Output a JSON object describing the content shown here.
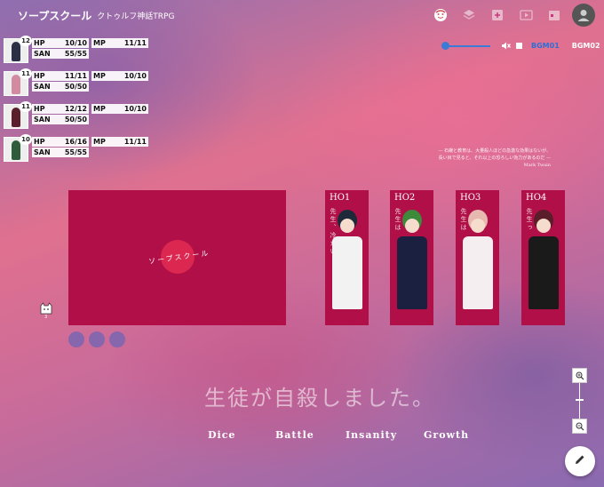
{
  "app": {
    "title": "ソープスクール",
    "subtitle": "クトゥルフ神話TRPG"
  },
  "toolbar": {
    "icons": [
      "face-icon",
      "layers-icon",
      "add-box-icon",
      "play-icon",
      "calendar-icon",
      "account-icon"
    ]
  },
  "bgm": {
    "volume": 0.0,
    "tracks": [
      "BGM01",
      "BGM02"
    ],
    "active_track": "BGM01"
  },
  "characters": [
    {
      "badge": "12",
      "hp_label": "HP",
      "hp": "10/10",
      "mp_label": "MP",
      "mp": "11/11",
      "san_label": "SAN",
      "san": "55/55",
      "color": "#2a2f45"
    },
    {
      "badge": "11",
      "hp_label": "HP",
      "hp": "11/11",
      "mp_label": "MP",
      "mp": "10/10",
      "san_label": "SAN",
      "san": "50/50",
      "color": "#d28ba0"
    },
    {
      "badge": "11",
      "hp_label": "HP",
      "hp": "12/12",
      "mp_label": "MP",
      "mp": "10/10",
      "san_label": "SAN",
      "san": "50/50",
      "color": "#5a1f2a"
    },
    {
      "badge": "10",
      "hp_label": "HP",
      "hp": "16/16",
      "mp_label": "MP",
      "mp": "11/11",
      "san_label": "SAN",
      "san": "55/55",
      "color": "#2e5b3a"
    }
  ],
  "quote": {
    "line1": "— 石鹸と教育は、大量殺人ほどの急激な効果はないが、",
    "line2": "長い目で見ると、それ以上の恐ろしい効力があるのだ —",
    "author": "Mark Twain"
  },
  "logo": {
    "text": "ソープスクール"
  },
  "ho_cards": [
    {
      "label": "HO1",
      "vertical": "先生、冷たい",
      "hair": "#1e2a3a",
      "coat": "#f2f2f2"
    },
    {
      "label": "HO2",
      "vertical": "先生は",
      "hair": "#3c8a3a",
      "coat": "#1c2040"
    },
    {
      "label": "HO3",
      "vertical": "先生は",
      "hair": "#e7b8b0",
      "coat": "#f4eef0"
    },
    {
      "label": "HO4",
      "vertical": "先生っ",
      "hair": "#5a1e2a",
      "coat": "#1a1a1a"
    }
  ],
  "tagline": "生徒が自殺しました。",
  "menu": [
    "Dice",
    "Battle",
    "Insanity",
    "Growth"
  ],
  "cat": {
    "icon": "cat-icon",
    "count": "3"
  }
}
